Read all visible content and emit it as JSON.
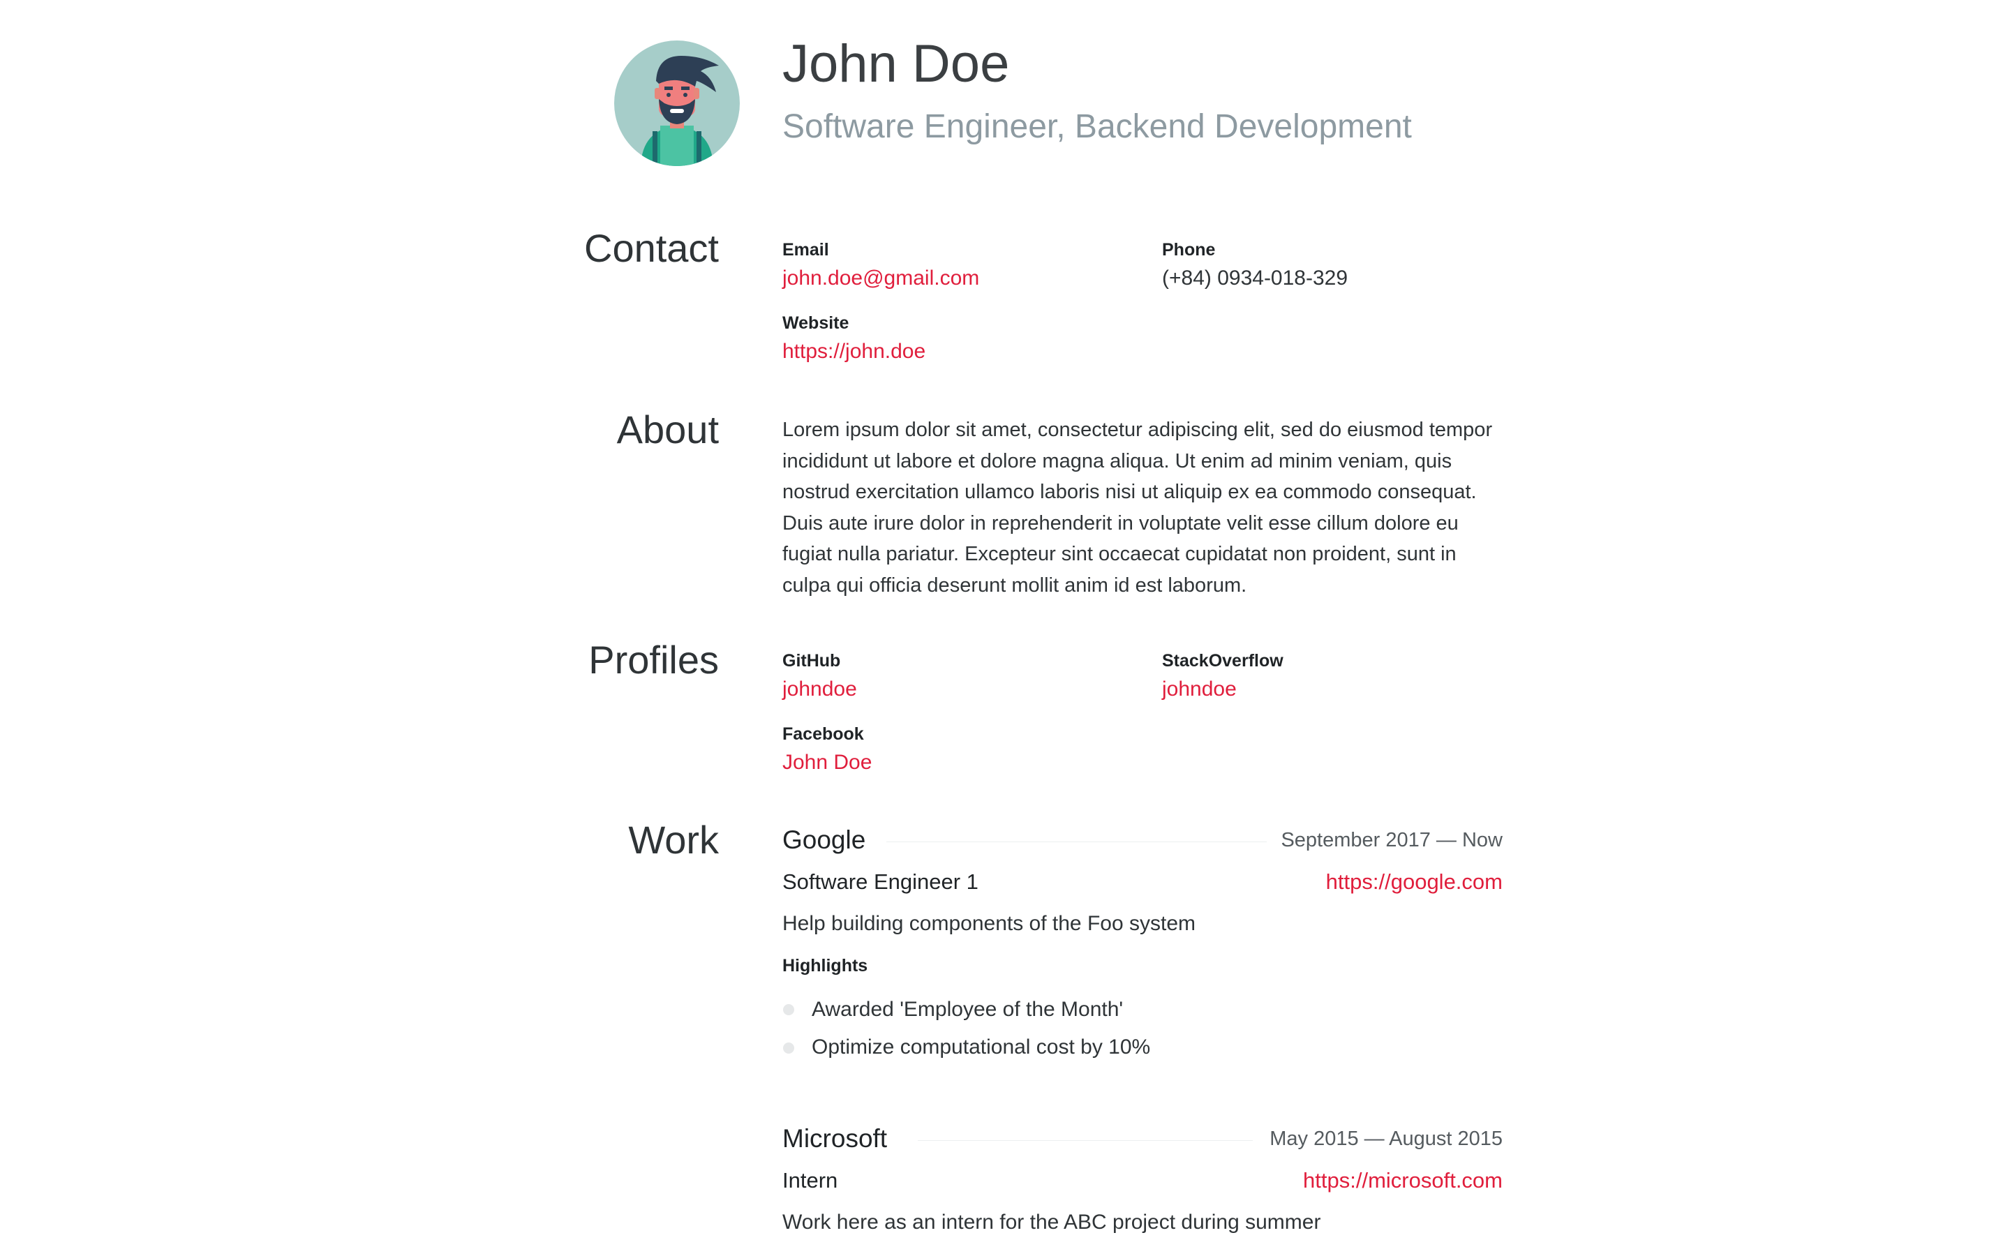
{
  "header": {
    "name": "John Doe",
    "title": "Software Engineer, Backend Development"
  },
  "sections": {
    "contact": "Contact",
    "about": "About",
    "profiles": "Profiles",
    "work": "Work"
  },
  "contact": {
    "email_label": "Email",
    "email": "john.doe@gmail.com",
    "phone_label": "Phone",
    "phone": "(+84) 0934-018-329",
    "website_label": "Website",
    "website": "https://john.doe"
  },
  "about": "Lorem ipsum dolor sit amet, consectetur adipiscing elit, sed do eiusmod tempor incididunt ut labore et dolore magna aliqua. Ut enim ad minim veniam, quis nostrud exercitation ullamco laboris nisi ut aliquip ex ea commodo consequat. Duis aute irure dolor in reprehenderit in voluptate velit esse cillum dolore eu fugiat nulla pariatur. Excepteur sint occaecat cupidatat non proident, sunt in culpa qui officia deserunt mollit anim id est laborum.",
  "profiles": [
    {
      "network": "GitHub",
      "username": "johndoe"
    },
    {
      "network": "StackOverflow",
      "username": "johndoe"
    },
    {
      "network": "Facebook",
      "username": "John Doe"
    }
  ],
  "work": [
    {
      "company": "Google",
      "dates": "September 2017 — Now",
      "position": "Software Engineer 1",
      "url": "https://google.com",
      "summary": "Help building components of the Foo system",
      "highlights_label": "Highlights",
      "highlights": [
        "Awarded 'Employee of the Month'",
        "Optimize computational cost by 10%"
      ]
    },
    {
      "company": "Microsoft",
      "dates": "May 2015 — August 2015",
      "position": "Intern",
      "url": "https://microsoft.com",
      "summary": "Work here as an intern for the ABC project during summer"
    }
  ],
  "colors": {
    "accent": "#e01e3c",
    "subtitle": "#8d9aa1",
    "text": "#2f3437",
    "avatar_bg": "#a6cdc9"
  },
  "icons": {
    "avatar": "bearded-man-avatar-icon"
  }
}
